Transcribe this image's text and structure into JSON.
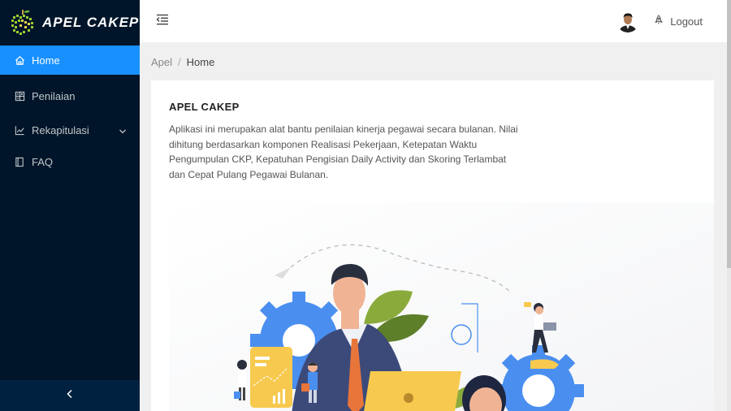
{
  "app": {
    "logo_text": "APEL CAKEP"
  },
  "sidebar": {
    "items": [
      {
        "label": "Home",
        "icon": "home-icon",
        "active": true
      },
      {
        "label": "Penilaian",
        "icon": "calculator-icon",
        "active": false
      },
      {
        "label": "Rekapitulasi",
        "icon": "line-chart-icon",
        "active": false
      },
      {
        "label": "FAQ",
        "icon": "book-icon",
        "active": false
      }
    ],
    "collapse_icon": "chevron-left-icon"
  },
  "header": {
    "logout_label": "Logout"
  },
  "breadcrumb": {
    "root": "Apel",
    "separator": "/",
    "current": "Home"
  },
  "card": {
    "title": "APEL CAKEP",
    "description": "Aplikasi ini merupakan alat bantu penilaian kinerja pegawai secara bulanan. Nilai dihitung berdasarkan komponen Realisasi Pekerjaan, Ketepatan Waktu Pengumpulan CKP, Kepatuhan Pengisian Daily Activity dan Skoring Terlambat dan Cepat Pulang Pegawai Bulanan."
  },
  "colors": {
    "sidebar_bg": "#001529",
    "active_item": "#1890ff",
    "gear_blue": "#4a8ff0",
    "accent_orange": "#e8753a",
    "illus_yellow": "#f7c94e"
  }
}
